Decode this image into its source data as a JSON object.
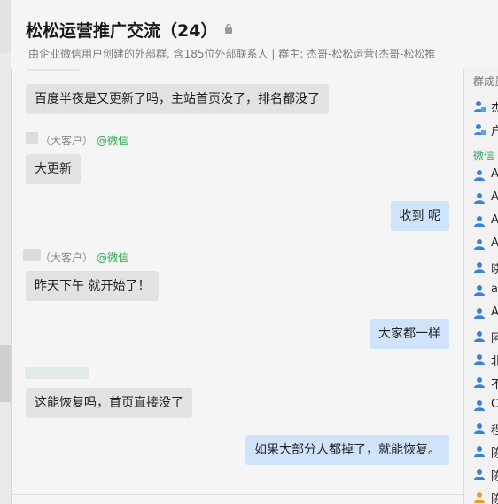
{
  "header": {
    "title": "松松运营推广交流",
    "member_count": "（24）",
    "lock_icon": "lock-icon",
    "subtitle": "由企业微信用户创建的外部群, 含185位外部联系人 | 群主: 杰哥-松松运营(杰哥-松松推"
  },
  "messages": [
    {
      "type": "in",
      "text": "百度半夜是又更新了吗，主站首页没了，排名都没了"
    },
    {
      "type": "sender",
      "tag": "（大客户）",
      "source": "@微信"
    },
    {
      "type": "in",
      "text": "大更新"
    },
    {
      "type": "out",
      "text": "收到 呢"
    },
    {
      "type": "sender",
      "tag": "（大客户）",
      "source": "@微信"
    },
    {
      "type": "in",
      "text": "昨天下午  就开始了！"
    },
    {
      "type": "out",
      "text": "大家都一样"
    },
    {
      "type": "in",
      "text": "这能恢复吗，首页直接没了"
    },
    {
      "type": "out",
      "text": "如果大部分人都掉了，就能恢复。"
    }
  ],
  "right_panel": {
    "section_group_owner": "群成员",
    "owners": [
      {
        "initial": "杰",
        "icon": "enterprise-user-icon"
      },
      {
        "initial": "户",
        "icon": "enterprise-user-icon"
      }
    ],
    "section_wechat": "微信",
    "members": [
      "A",
      "A",
      "A",
      "A",
      "晓",
      "a",
      "A",
      "阿",
      "北",
      "不",
      "C",
      "程",
      "陈",
      "陈",
      "陈"
    ],
    "member_icon": "user-icon",
    "colors": {
      "member_icon": "#3b82d6",
      "last_member_icon": "#f09a2a"
    }
  },
  "colors": {
    "background": "#f5f5f5",
    "bubble_incoming": "#e2e2e2",
    "bubble_outgoing": "#cfe3fb",
    "wechat_green": "#2fa955"
  }
}
